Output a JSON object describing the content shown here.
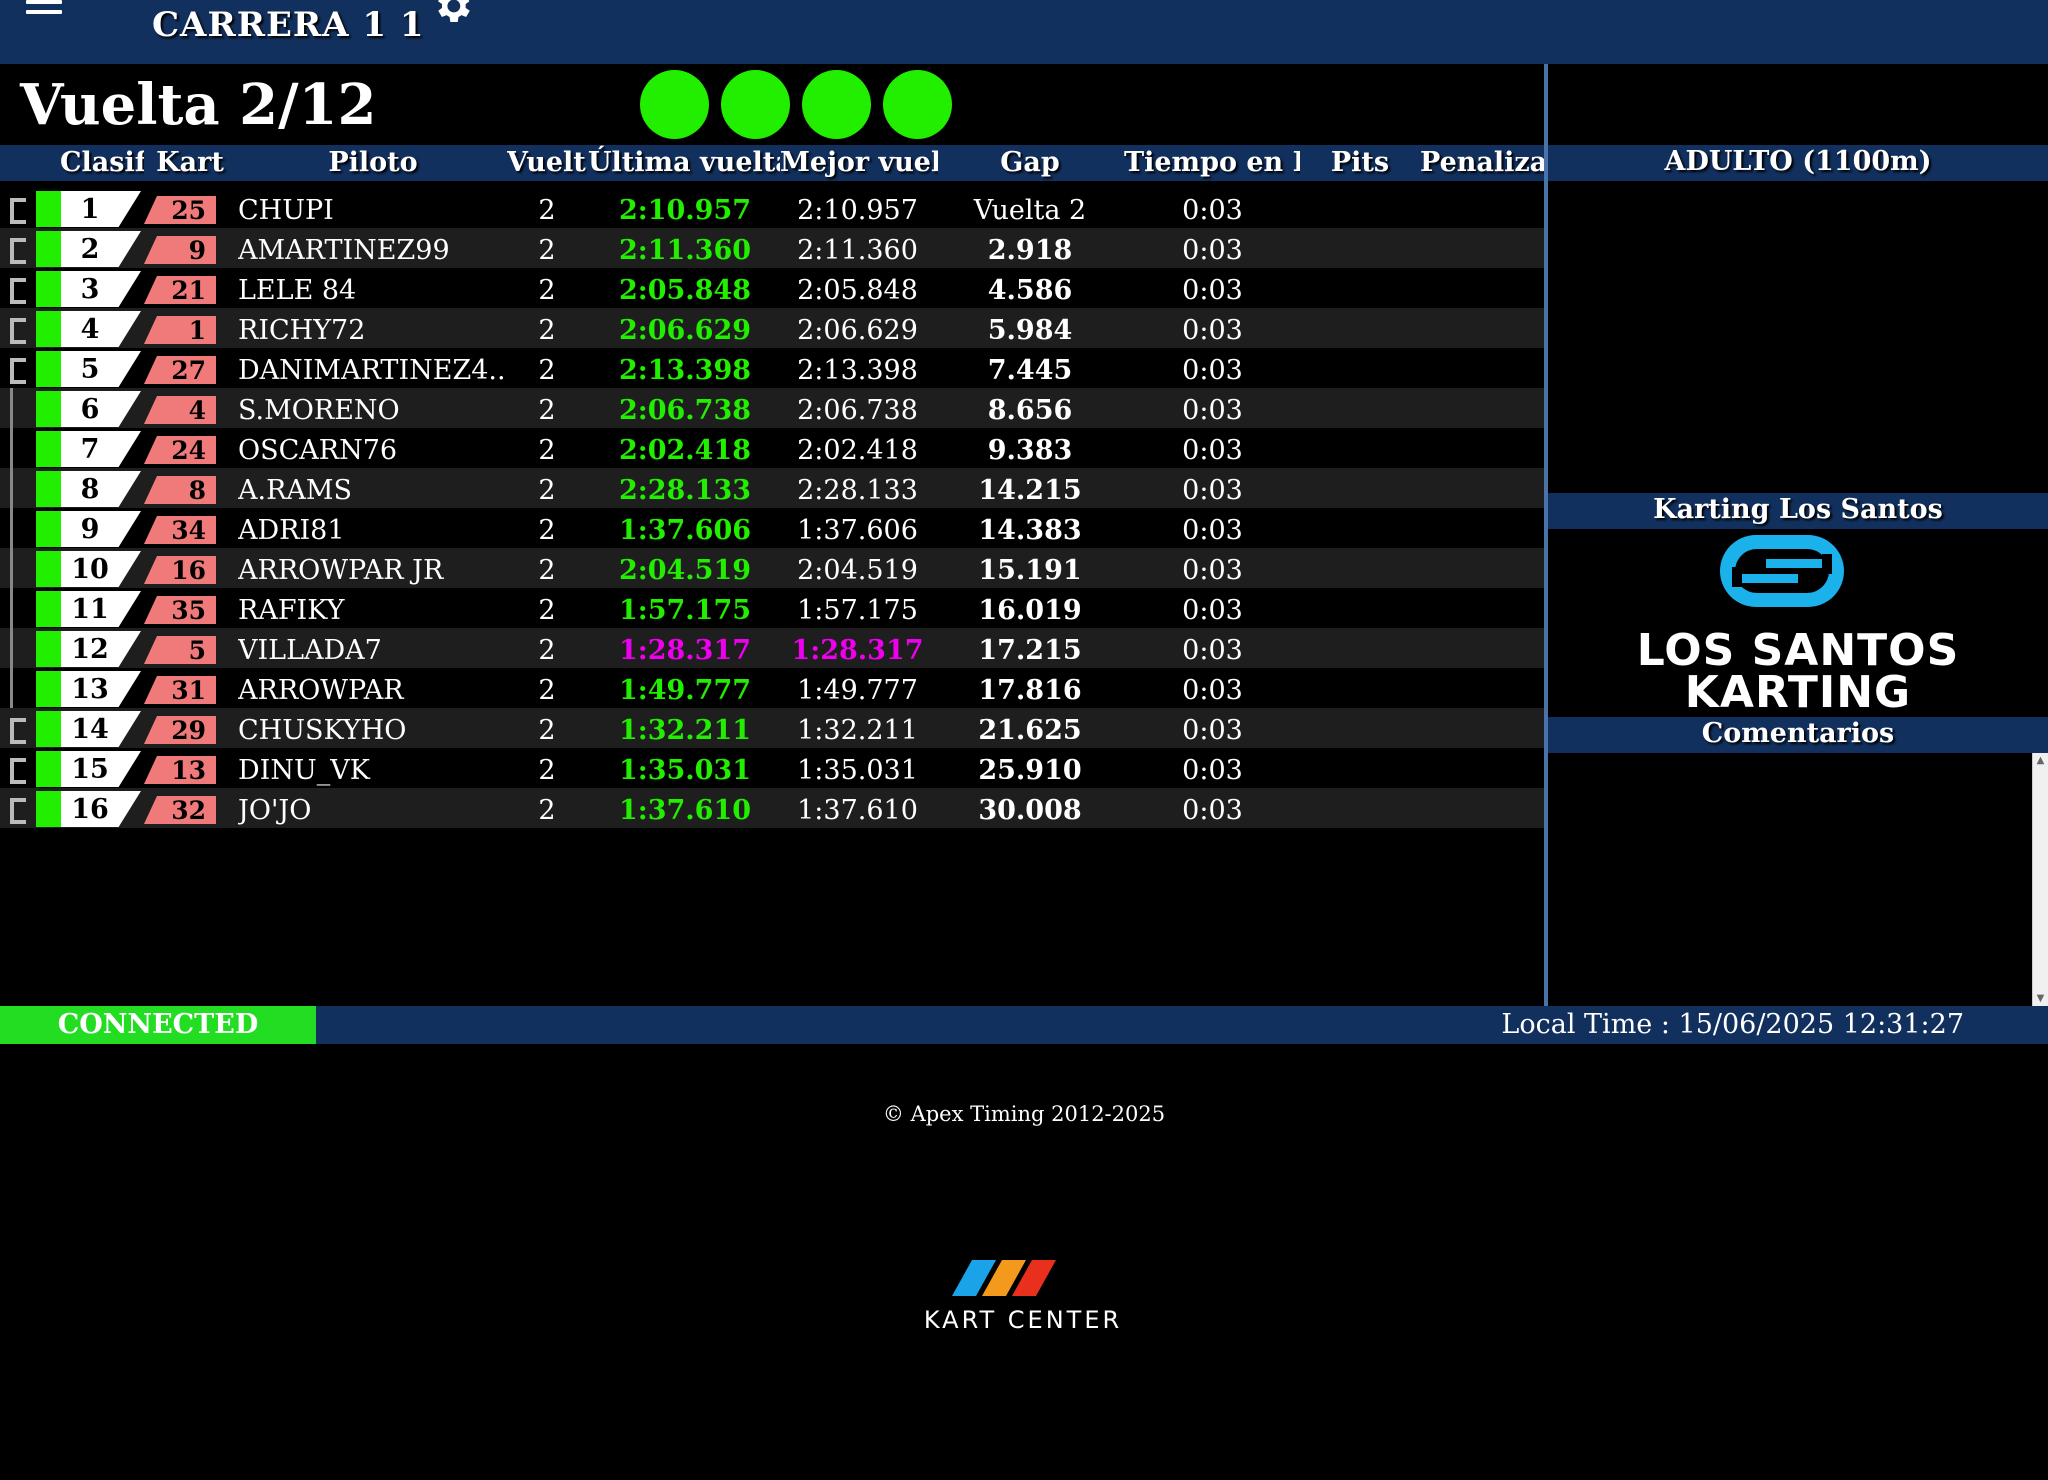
{
  "header": {
    "race_title": "CARRERA 1 1",
    "menu_icon": "hamburger-menu-icon",
    "settings_icon": "gear-icon"
  },
  "lap_counter": "Vuelta 2/12",
  "start_lights": [
    "green",
    "green",
    "green",
    "green"
  ],
  "colors": {
    "header_bg": "#12305e",
    "lap_green": "#22ee00",
    "best_purple": "#ee00ee",
    "kart_badge": "#f07a7a",
    "connected": "#22dd22"
  },
  "table": {
    "columns": [
      "Clasif",
      "Kart",
      "Piloto",
      "Vuelta",
      "Última vuelta",
      "Mejor vuel",
      "Gap",
      "Tiempo en I",
      "Pits",
      "Penaliza"
    ],
    "rows": [
      {
        "pos": "1",
        "kart": "25",
        "pilot": "CHUPI",
        "laps": "2",
        "last": "2:10.957",
        "best": "2:10.957",
        "gap": "Vuelta 2",
        "time": "0:03",
        "highlight": false
      },
      {
        "pos": "2",
        "kart": "9",
        "pilot": "AMARTINEZ99",
        "laps": "2",
        "last": "2:11.360",
        "best": "2:11.360",
        "gap": "2.918",
        "time": "0:03",
        "highlight": false
      },
      {
        "pos": "3",
        "kart": "21",
        "pilot": "LELE 84",
        "laps": "2",
        "last": "2:05.848",
        "best": "2:05.848",
        "gap": "4.586",
        "time": "0:03",
        "highlight": false
      },
      {
        "pos": "4",
        "kart": "1",
        "pilot": "RICHY72",
        "laps": "2",
        "last": "2:06.629",
        "best": "2:06.629",
        "gap": "5.984",
        "time": "0:03",
        "highlight": false
      },
      {
        "pos": "5",
        "kart": "27",
        "pilot": "DANIMARTINEZ4...",
        "laps": "2",
        "last": "2:13.398",
        "best": "2:13.398",
        "gap": "7.445",
        "time": "0:03",
        "highlight": false
      },
      {
        "pos": "6",
        "kart": "4",
        "pilot": "S.MORENO",
        "laps": "2",
        "last": "2:06.738",
        "best": "2:06.738",
        "gap": "8.656",
        "time": "0:03",
        "highlight": false
      },
      {
        "pos": "7",
        "kart": "24",
        "pilot": "OSCARN76",
        "laps": "2",
        "last": "2:02.418",
        "best": "2:02.418",
        "gap": "9.383",
        "time": "0:03",
        "highlight": false
      },
      {
        "pos": "8",
        "kart": "8",
        "pilot": "A.RAMS",
        "laps": "2",
        "last": "2:28.133",
        "best": "2:28.133",
        "gap": "14.215",
        "time": "0:03",
        "highlight": false
      },
      {
        "pos": "9",
        "kart": "34",
        "pilot": "ADRI81",
        "laps": "2",
        "last": "1:37.606",
        "best": "1:37.606",
        "gap": "14.383",
        "time": "0:03",
        "highlight": false
      },
      {
        "pos": "10",
        "kart": "16",
        "pilot": "ARROWPAR JR",
        "laps": "2",
        "last": "2:04.519",
        "best": "2:04.519",
        "gap": "15.191",
        "time": "0:03",
        "highlight": false
      },
      {
        "pos": "11",
        "kart": "35",
        "pilot": "RAFIKY",
        "laps": "2",
        "last": "1:57.175",
        "best": "1:57.175",
        "gap": "16.019",
        "time": "0:03",
        "highlight": false
      },
      {
        "pos": "12",
        "kart": "5",
        "pilot": "VILLADA7",
        "laps": "2",
        "last": "1:28.317",
        "best": "1:28.317",
        "gap": "17.215",
        "time": "0:03",
        "highlight": true
      },
      {
        "pos": "13",
        "kart": "31",
        "pilot": "ARROWPAR",
        "laps": "2",
        "last": "1:49.777",
        "best": "1:49.777",
        "gap": "17.816",
        "time": "0:03",
        "highlight": false
      },
      {
        "pos": "14",
        "kart": "29",
        "pilot": "CHUSKYHO",
        "laps": "2",
        "last": "1:32.211",
        "best": "1:32.211",
        "gap": "21.625",
        "time": "0:03",
        "highlight": false
      },
      {
        "pos": "15",
        "kart": "13",
        "pilot": "DINU_VK",
        "laps": "2",
        "last": "1:35.031",
        "best": "1:35.031",
        "gap": "25.910",
        "time": "0:03",
        "highlight": false
      },
      {
        "pos": "16",
        "kart": "32",
        "pilot": "JO'JO",
        "laps": "2",
        "last": "1:37.610",
        "best": "1:37.610",
        "gap": "30.008",
        "time": "0:03",
        "highlight": false
      }
    ]
  },
  "right_panel": {
    "category": "ADULTO (1100m)",
    "track_name": "Karting Los Santos",
    "logo_line1": "LOS SANTOS",
    "logo_line2": "KARTING",
    "comments_title": "Comentarios"
  },
  "status": {
    "connection": "CONNECTED",
    "local_time": "Local Time : 15/06/2025 12:31:27"
  },
  "footer": {
    "copyright": "© Apex Timing 2012-2025",
    "brand": "KART CENTER"
  }
}
